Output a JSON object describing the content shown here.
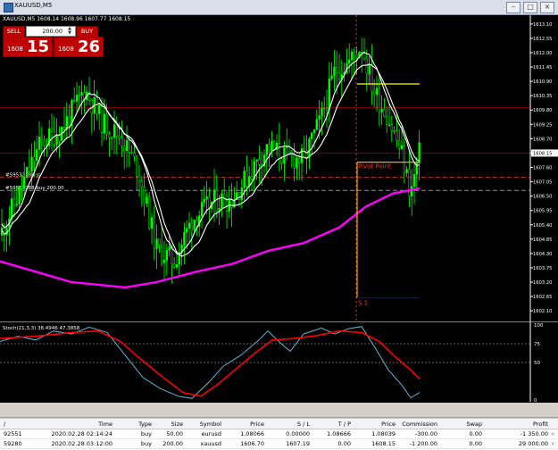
{
  "window": {
    "title": "XAUUSD,M5"
  },
  "one_click": {
    "symbol_label": "XAUUSD,M5  1608.14 1608.96 1607.77 1608.15",
    "sell_label": "SELL",
    "buy_label": "BUY",
    "lot": "200.00",
    "sell_price_small": "1608",
    "sell_price_big": "15",
    "buy_price_small": "1608",
    "buy_price_big": "26"
  },
  "chart": {
    "price_axis": [
      "1613.10",
      "1612.55",
      "1612.00",
      "1611.45",
      "1610.90",
      "1610.35",
      "1609.80",
      "1609.25",
      "1608.70",
      "1608.15",
      "1607.60",
      "1607.05",
      "1606.50",
      "1605.95",
      "1605.40",
      "1604.85",
      "1604.30",
      "1603.75",
      "1603.20",
      "1602.65",
      "1602.10"
    ],
    "current_price": "1608.15",
    "pivot_label": "Pivot Point",
    "s1_label": "S 1",
    "sl_label": "#59533288 sl",
    "buy_label": "#59533288 buy 200.00"
  },
  "oscillator": {
    "label": "Stoch(21,3,3) 38.4946 47.3858",
    "levels": [
      "100",
      "75",
      "50",
      "0"
    ]
  },
  "trade": {
    "headers": [
      "/",
      "Time",
      "Type",
      "Size",
      "Symbol",
      "Price",
      "S / L",
      "T / P",
      "Price",
      "Commission",
      "Swap",
      "Profit"
    ],
    "rows": [
      [
        "92551",
        "2020.02.28 02:14:24",
        "buy",
        "50.00",
        "eurusd",
        "1.08066",
        "0.00000",
        "1.08666",
        "1.08039",
        "-300.00",
        "0.00",
        "-1 350.00"
      ],
      [
        "59280",
        "2020.02.28 03:12:00",
        "buy",
        "200.00",
        "xauusd",
        "1606.70",
        "1607.19",
        "0.00",
        "1608.15",
        "-1 200.00",
        "0.00",
        "29 000.00"
      ]
    ]
  },
  "colors": {
    "background": "#000000",
    "bull_candle": "#00ff00",
    "ma1": "#ffffff",
    "ma2": "#ffffff",
    "ma_slow": "#ff00ff",
    "stoch_main": "#5fb7d8",
    "stoch_signal": "#ff0000",
    "pivot": "#ffa500",
    "resistance": "#ffff00",
    "support": "#0000ff"
  }
}
